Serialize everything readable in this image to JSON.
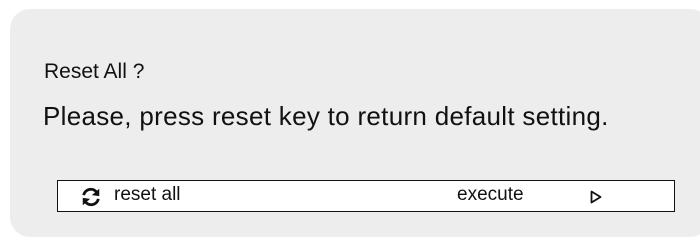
{
  "dialog": {
    "title": "Reset All ?",
    "message": "Please, press  reset key to return default setting."
  },
  "option_row": {
    "icon": "refresh-icon",
    "label": "reset all",
    "action_label": "execute",
    "arrow_icon": "play-arrow-icon"
  }
}
